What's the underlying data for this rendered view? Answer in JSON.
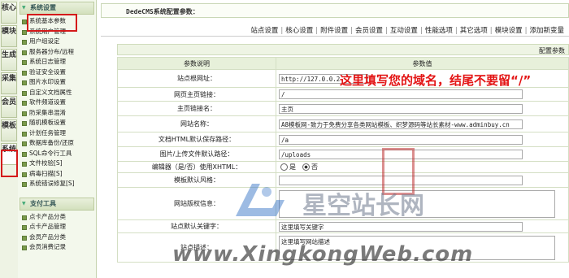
{
  "vertical_tabs": [
    "核心",
    "模块",
    "生成",
    "采集",
    "会员",
    "模板",
    "系统"
  ],
  "menu": {
    "section1_title": "系统设置",
    "section1_items": [
      "系统基本参数",
      "系统用户管理",
      "用户组设定",
      "服务器分布/远程",
      "系统日志管理",
      "验证安全设置",
      "图片水印设置",
      "自定义文档属性",
      "软件频道设置",
      "防采集串混淆",
      "随机模板设置",
      "计划任务管理",
      "数据库备份/还原",
      "SQL命令行工具",
      "文件校验[S]",
      "病毒扫描[S]",
      "系统错误修复[S]"
    ],
    "section2_title": "支付工具",
    "section2_items": [
      "点卡产品分类",
      "点卡产品管理",
      "会员产品分类",
      "会员消费记录"
    ]
  },
  "content": {
    "title": "DedeCMS系统配置参数：",
    "toolbar": [
      "站点设置",
      "核心设置",
      "附件设置",
      "会员设置",
      "互动设置",
      "性能选项",
      "其它选项",
      "模块设置",
      "添加新变量"
    ],
    "subbar_text": "配置参数",
    "table_header": {
      "label_col": "参数说明",
      "value_col": "参数值"
    },
    "rows": [
      {
        "label": "站点根网址：",
        "value": "http://127.0.0.2",
        "kind": "input",
        "width": 110
      },
      {
        "label": "网页主页链接：",
        "value": "/",
        "kind": "input",
        "width": 300
      },
      {
        "label": "主页链接名：",
        "value": "主页",
        "kind": "input",
        "width": 300
      },
      {
        "label": "网站名称：",
        "value": "A8模板网-致力于免费分享各类网站模板、织梦源码等站长素材-www.adminbuy.cn",
        "kind": "input",
        "width": 300
      },
      {
        "label": "文档HTML默认保存路径：",
        "value": "/a",
        "kind": "input",
        "width": 300
      },
      {
        "label": "图片/上传文件默认路径：",
        "value": "/uploads",
        "kind": "input",
        "width": 300
      },
      {
        "label": "编辑器（是/否）使用XHTML：",
        "kind": "radio",
        "options": [
          "是",
          "否"
        ],
        "selected": 1
      },
      {
        "label": "模板默认风格：",
        "value": "",
        "kind": "input",
        "width": 300
      },
      {
        "label": "网站版权信息：",
        "value": "",
        "kind": "textarea"
      },
      {
        "label": "站点默认关键字：",
        "value": "这里填写关键字",
        "kind": "input",
        "width": 300
      },
      {
        "label": "站点描述：",
        "value": "这里填写网站描述",
        "kind": "textarea"
      }
    ]
  },
  "annotation": "这里填写您的域名，结尾不要留“/”",
  "watermark": {
    "text": "星空站长网",
    "url": "www.XingkongWeb.com"
  }
}
